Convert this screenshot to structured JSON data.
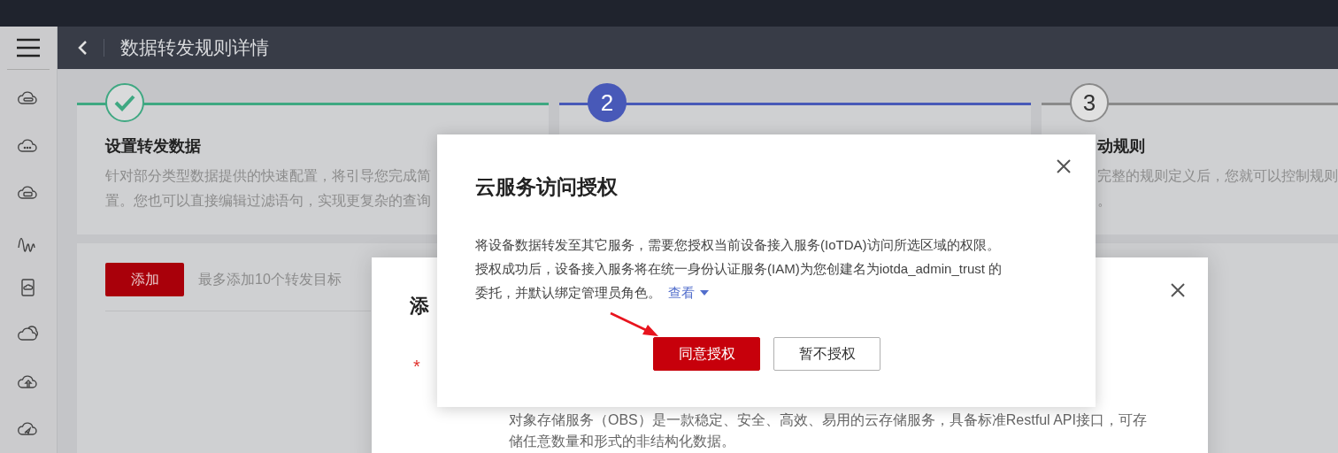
{
  "header": {
    "title": "数据转发规则详情"
  },
  "steps": [
    {
      "kind": "done",
      "title": "设置转发数据",
      "description": [
        "针对部分类型数据提供的快速配置，将引导您完成简",
        "置。您也可以直接编辑过滤语句，实现更复杂的查询"
      ]
    },
    {
      "number": "2",
      "kind": "current"
    },
    {
      "number": "3",
      "kind": "pending",
      "title": "动规则",
      "description": [
        "完整的规则定义后，您就可以控制规则",
        "。"
      ]
    }
  ],
  "targets": {
    "add_button": "添加",
    "hint": "最多添加10个转发目标"
  },
  "add_dialog": {
    "title": "添",
    "required_mark": "*",
    "description": [
      "对象存储服务（OBS）是一款稳定、安全、高效、易用的云存储服务，具备标准Restful API接口，可存",
      "储任意数量和形式的非结构化数据。"
    ]
  },
  "auth_dialog": {
    "title": "云服务访问授权",
    "body": [
      "将设备数据转发至其它服务，需要您授权当前设备接入服务(IoTDA)访问所选区域的权限。",
      "授权成功后，设备接入服务将在统一身份认证服务(IAM)为您创建名为iotda_admin_trust 的",
      "委托，并默认绑定管理员角色。"
    ],
    "link": "查看",
    "buttons": [
      {
        "label": "同意授权",
        "primary": true
      },
      {
        "label": "暂不授权",
        "primary": false
      }
    ]
  }
}
